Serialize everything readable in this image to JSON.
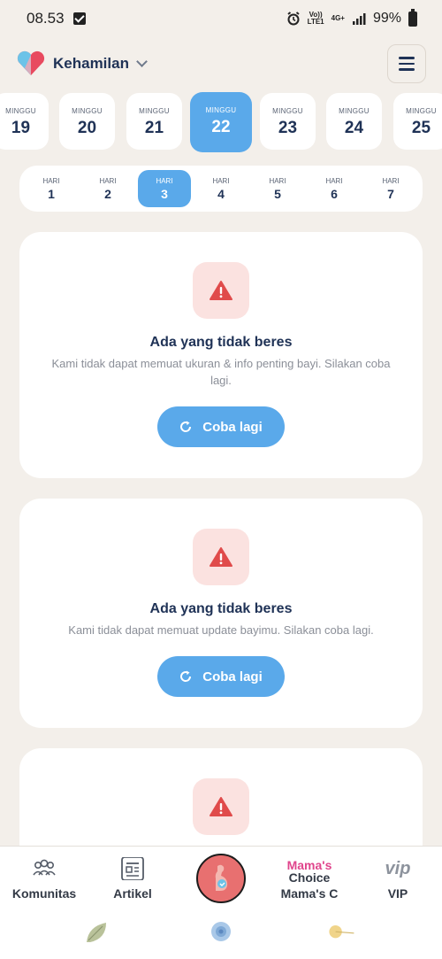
{
  "status_bar": {
    "time": "08.53",
    "network_top": "Vo))",
    "network_bottom": "LTE1",
    "signal_type": "4G+",
    "battery": "99%"
  },
  "header": {
    "title": "Kehamilan",
    "logo_icon": "heart-icon",
    "menu_icon": "hamburger-icon"
  },
  "weeks": [
    {
      "label": "MINGGU",
      "number": "19"
    },
    {
      "label": "MINGGU",
      "number": "20"
    },
    {
      "label": "MINGGU",
      "number": "21"
    },
    {
      "label": "MINGGU",
      "number": "22",
      "active": true
    },
    {
      "label": "MINGGU",
      "number": "23"
    },
    {
      "label": "MINGGU",
      "number": "24"
    },
    {
      "label": "MINGGU",
      "number": "25"
    }
  ],
  "days": [
    {
      "label": "HARI",
      "number": "1"
    },
    {
      "label": "HARI",
      "number": "2"
    },
    {
      "label": "HARI",
      "number": "3",
      "active": true
    },
    {
      "label": "HARI",
      "number": "4"
    },
    {
      "label": "HARI",
      "number": "5"
    },
    {
      "label": "HARI",
      "number": "6"
    },
    {
      "label": "HARI",
      "number": "7"
    }
  ],
  "cards": [
    {
      "title": "Ada yang tidak beres",
      "message": "Kami tidak dapat memuat ukuran & info penting bayi. Silakan coba lagi.",
      "retry_label": "Coba lagi"
    },
    {
      "title": "Ada yang tidak beres",
      "message": "Kami tidak dapat memuat update bayimu. Silakan coba lagi.",
      "retry_label": "Coba lagi"
    },
    {
      "title": "",
      "message": "",
      "retry_label": ""
    }
  ],
  "bottom_nav": {
    "komunitas": "Komunitas",
    "artikel": "Artikel",
    "mamas_choice_logo_1": "Mama's",
    "mamas_choice_logo_2": "Choice",
    "mamas_choice": "Mama's C",
    "vip_logo": "vip",
    "vip": "VIP"
  },
  "colors": {
    "accent": "#5aa9ea",
    "error": "#e04b4b",
    "error_bg": "#fbe2e0",
    "background": "#f3efea",
    "brand_pink": "#e0458c"
  }
}
